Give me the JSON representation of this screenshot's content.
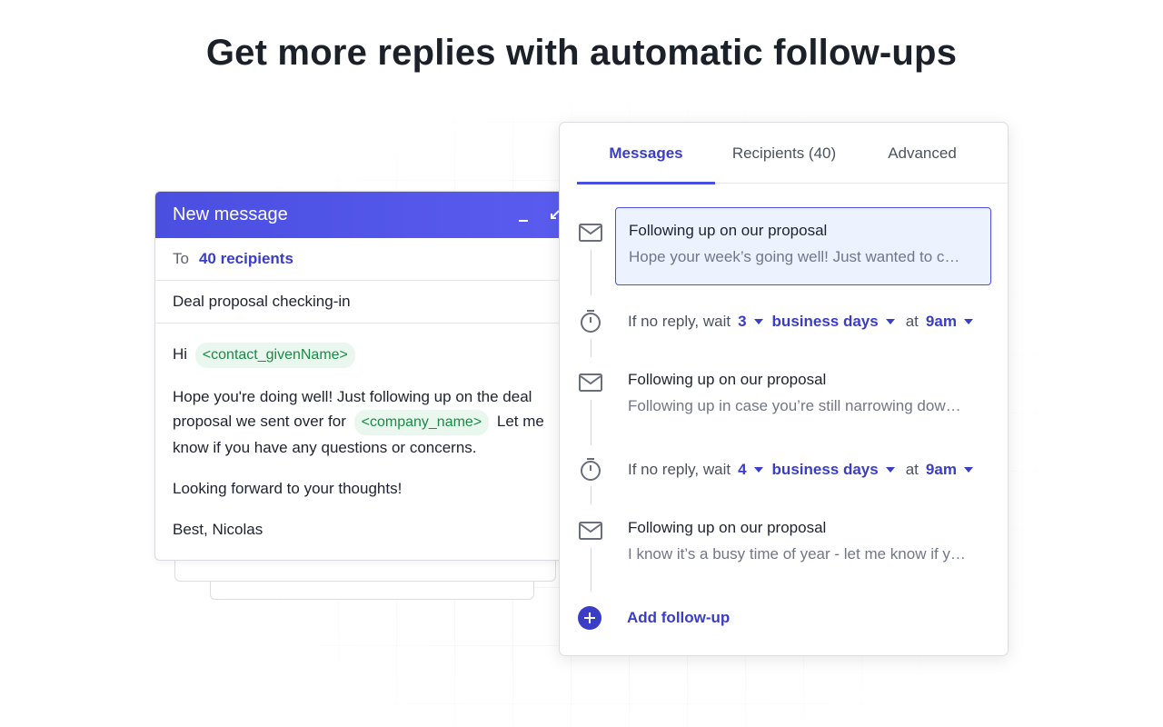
{
  "headline": "Get more replies with automatic follow-ups",
  "compose": {
    "title": "New message",
    "to_label": "To",
    "to_value": "40 recipients",
    "subject": "Deal proposal checking-in",
    "greeting": "Hi",
    "greeting_chip": "<contact_givenName>",
    "para1_line1": "Hope you're doing well! Just following up on the deal",
    "para1_line2_pre": "proposal we sent over for",
    "para1_chip": "<company_name>",
    "para1_line2_post": "Let me",
    "para1_line3": "know if you have any questions or concerns.",
    "para2": "Looking forward to your thoughts!",
    "signoff": "Best, Nicolas"
  },
  "panel": {
    "tabs": [
      {
        "label": "Messages"
      },
      {
        "label": "Recipients (40)"
      },
      {
        "label": "Advanced"
      }
    ],
    "messages": [
      {
        "title": "Following up on our proposal",
        "preview": "Hope your week’s going well! Just wanted to c…"
      },
      {
        "title": "Following up on our proposal",
        "preview": "Following up in case you’re still narrowing dow…"
      },
      {
        "title": "Following up on our proposal",
        "preview": "I know it’s a busy time of year - let me know if y…"
      }
    ],
    "waits": [
      {
        "prefix": "If no reply, wait",
        "days": "3",
        "unit": "business days",
        "at": "at",
        "time": "9am"
      },
      {
        "prefix": "If no reply, wait",
        "days": "4",
        "unit": "business days",
        "at": "at",
        "time": "9am"
      }
    ],
    "add_label": "Add follow-up"
  },
  "colors": {
    "accent": "#4a4fe0",
    "link": "#3a3dc8",
    "chip_bg": "#e9f7ee",
    "chip_text": "#1c8a47"
  }
}
